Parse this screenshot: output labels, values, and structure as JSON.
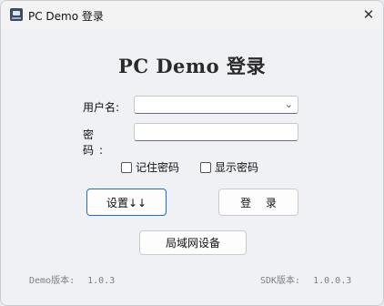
{
  "window": {
    "title": "PC Demo 登录",
    "close_glyph": "✕"
  },
  "heading": "PC Demo 登录",
  "form": {
    "username_label": "用户名:",
    "username_value": "",
    "password_label": "密 码:",
    "password_value": "",
    "dropdown_glyph": "⌄"
  },
  "options": {
    "remember_password": "记住密码",
    "show_password": "显示密码"
  },
  "buttons": {
    "settings": "设置↓↓",
    "login": "登 录",
    "lan_device": "局域网设备"
  },
  "versions": {
    "demo_label": "Demo版本:",
    "demo_value": "1.0.3",
    "sdk_label": "SDK版本:",
    "sdk_value": "1.0.0.3"
  },
  "colors": {
    "accent": "#1e6fc0",
    "background": "#f0f1f5"
  }
}
